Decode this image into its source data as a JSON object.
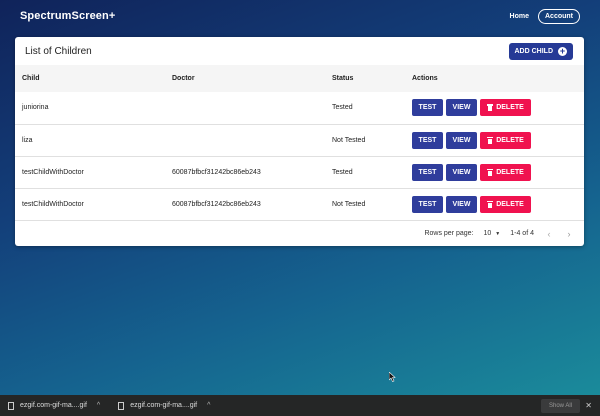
{
  "app": {
    "brand": "SpectrumScreen+"
  },
  "nav": {
    "home": "Home",
    "account": "Account"
  },
  "card": {
    "title": "List of Children",
    "add_button": "ADD CHILD"
  },
  "table": {
    "headers": {
      "child": "Child",
      "doctor": "Doctor",
      "status": "Status",
      "actions": "Actions"
    },
    "rows": [
      {
        "child": "juniorina",
        "doctor": "",
        "status": "Tested"
      },
      {
        "child": "liza",
        "doctor": "",
        "status": "Not Tested"
      },
      {
        "child": "testChildWithDoctor",
        "doctor": "60087bfbcf31242bc86eb243",
        "status": "Tested"
      },
      {
        "child": "testChildWithDoctor",
        "doctor": "60087bfbcf31242bc86eb243",
        "status": "Not Tested"
      }
    ],
    "action_labels": {
      "test": "TEST",
      "view": "VIEW",
      "delete": "DELETE"
    }
  },
  "pagination": {
    "rows_per_page_label": "Rows per page:",
    "rows_per_page": "10",
    "range": "1-4 of 4"
  },
  "downloads": {
    "items": [
      "ezgif.com-gif-ma....gif",
      "ezgif.com-gif-ma....gif"
    ],
    "show_all": "Show All"
  },
  "colors": {
    "primary": "#2f3d9c",
    "danger": "#f0124f",
    "brand_button": "#263a96"
  },
  "icons": {
    "add": "plus-circle-icon",
    "delete": "trash-icon",
    "prev": "chevron-left-icon",
    "next": "chevron-right-icon",
    "file": "file-icon",
    "close": "close-icon"
  }
}
